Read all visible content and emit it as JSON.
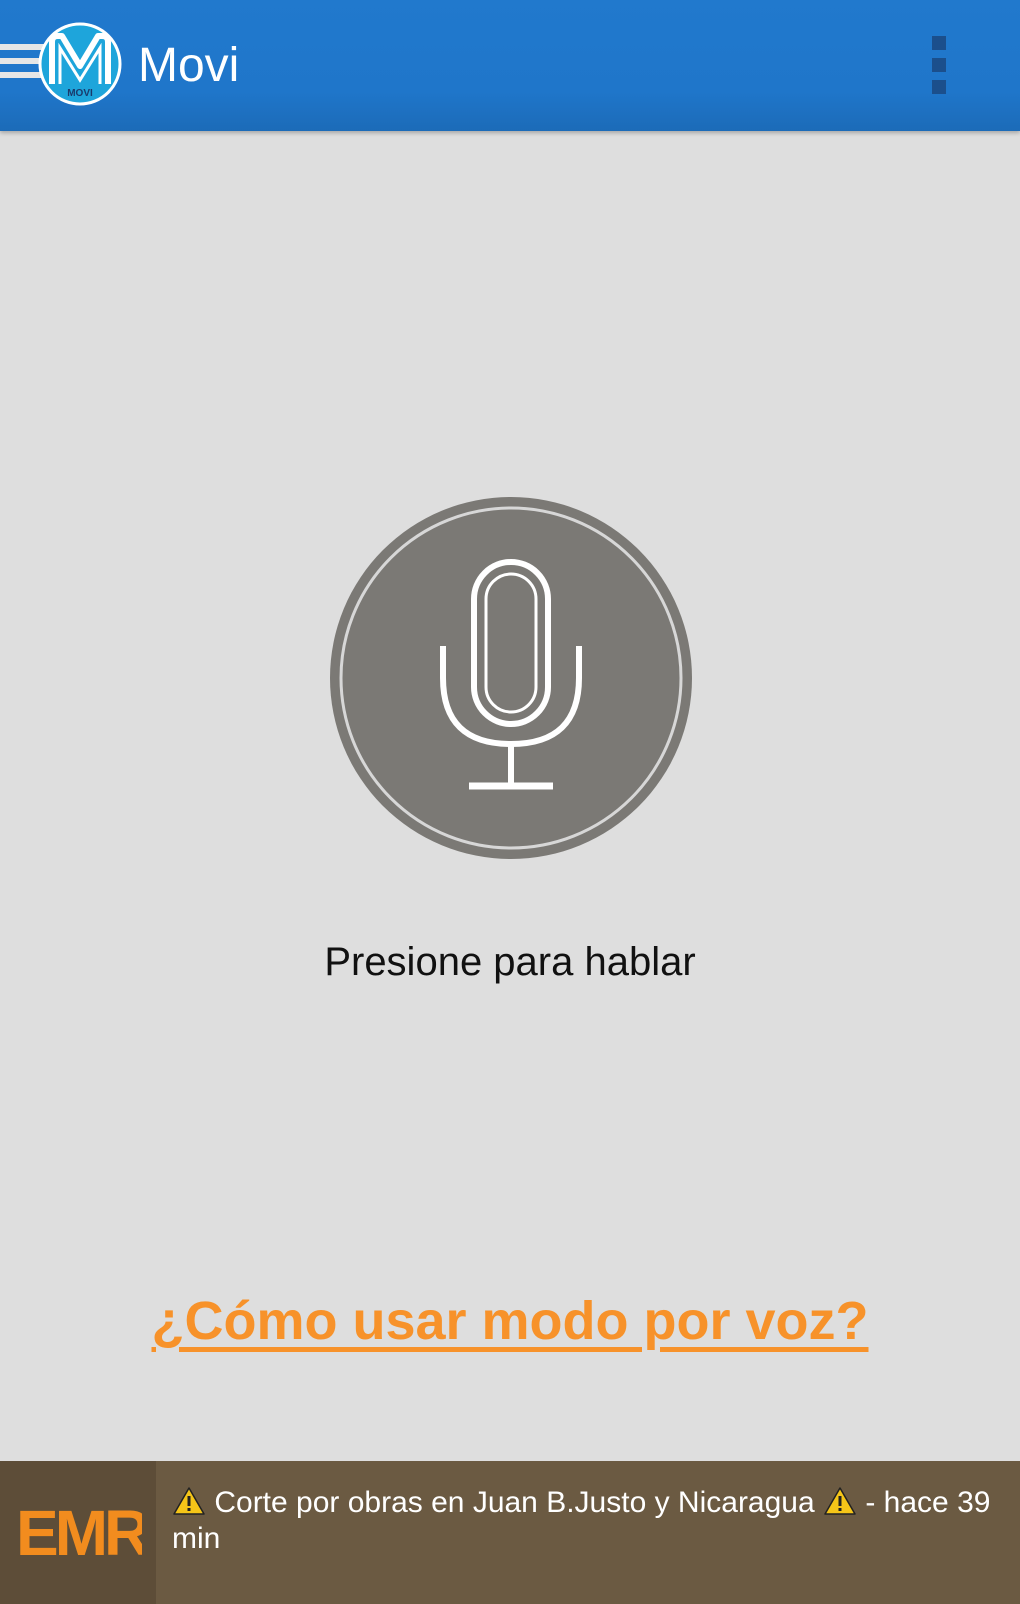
{
  "appbar": {
    "title": "Movi",
    "logo_text": "MOVI",
    "menu_icon": "hamburger-menu-icon",
    "overflow_icon": "overflow-menu-icon",
    "color": "#2179cd"
  },
  "voice": {
    "mic_icon": "microphone-icon",
    "prompt": "Presione para hablar",
    "help_link": "¿Cómo usar modo por voz?",
    "mic_color": "#7b7975",
    "link_color": "#f7922a"
  },
  "alert": {
    "source_logo": "EMR",
    "icon": "warning-icon",
    "message_before": "Corte por obras en Juan B.Justo y Nicaragua",
    "message_after": "- hace 39 min",
    "logo_color": "#f28c1e"
  }
}
